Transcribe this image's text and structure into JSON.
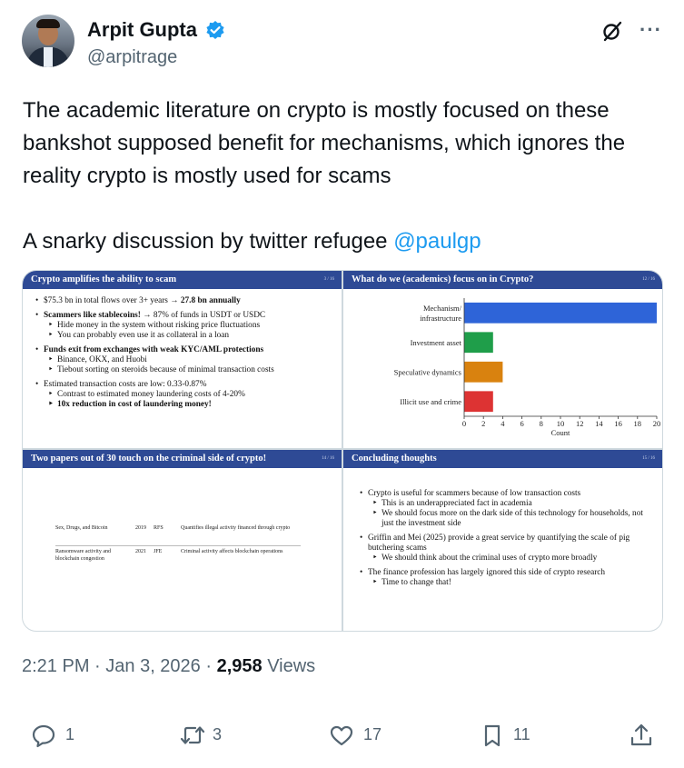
{
  "author": {
    "name": "Arpit Gupta",
    "handle": "@arpitrage"
  },
  "tweet": {
    "paragraph1": "The academic literature on crypto is mostly focused on these bankshot supposed benefit for mechanisms, which ignores the reality crypto is mostly used for scams",
    "paragraph2_prefix": "A snarky discussion by twitter refugee ",
    "mention": "@paulgp"
  },
  "slides": {
    "slide1": {
      "title": "Crypto amplifies the ability to scam",
      "page": "3 / 16",
      "b1_pre": "$75.3 bn in total flows over 3+ years → ",
      "b1_bold": "27.8 bn annually",
      "b2_bold": "Scammers like stablecoins!",
      "b2_rest": " → 87% of funds in USDT or USDC",
      "b2_sub1": "Hide money in the system without risking price fluctuations",
      "b2_sub2": "You can probably even use it as collateral in a loan",
      "b3_bold": "Funds exit from exchanges with weak KYC/AML protections",
      "b3_sub1": "Binance, OKX, and Huobi",
      "b3_sub2": "Tiebout sorting on steroids because of minimal transaction costs",
      "b4": "Estimated transaction costs are low: 0.33-0.87%",
      "b4_sub1": "Contrast to estimated money laundering costs of 4-20%",
      "b4_sub2_bold": "10x reduction in cost of laundering money!"
    },
    "slide2": {
      "title": "What do we (academics) focus on in Crypto?",
      "page": "12 / 16"
    },
    "slide3": {
      "title": "Two papers out of 30 touch on the criminal side of crypto!",
      "page": "14 / 16",
      "rows": [
        {
          "paper": "Sex, Drugs, and Bitcoin",
          "year": "2019",
          "journal": "RFS",
          "finding": "Quantifies illegal activity financed through crypto"
        },
        {
          "paper": "Ransomware activity and blockchain congestion",
          "year": "2021",
          "journal": "JFE",
          "finding": "Criminal activity affects blockchain operations"
        }
      ]
    },
    "slide4": {
      "title": "Concluding thoughts",
      "page": "15 / 16",
      "b1": "Crypto is useful for scammers because of low transaction costs",
      "b1_sub1": "This is an underappreciated fact in academia",
      "b1_sub2": "We should focus more on the dark side of this technology for households, not just the investment side",
      "b2": "Griffin and Mei (2025) provide a great service by quantifying the scale of pig butchering scams",
      "b2_sub1": "We should think about the criminal uses of crypto more broadly",
      "b3": "The finance profession has largely ignored this side of crypto research",
      "b3_sub1": "Time to change that!"
    }
  },
  "chart_data": {
    "type": "bar",
    "orientation": "horizontal",
    "categories": [
      "Mechanism/ infrastructure",
      "Investment asset",
      "Speculative dynamics",
      "Illicit use and crime"
    ],
    "category_lines": [
      [
        "Mechanism/",
        "infrastructure"
      ],
      [
        "Investment asset"
      ],
      [
        "Speculative dynamics"
      ],
      [
        "Illicit use and crime"
      ]
    ],
    "values": [
      20,
      3,
      4,
      3
    ],
    "colors": [
      "#2e64d8",
      "#1f9e4a",
      "#d9820f",
      "#dd3333"
    ],
    "xlabel": "Count",
    "xlim": [
      0,
      20
    ],
    "xticks": [
      0,
      2,
      4,
      6,
      8,
      10,
      12,
      14,
      16,
      18,
      20
    ],
    "xtick_labels": [
      "0",
      "2",
      "4",
      "6",
      "8",
      "10",
      "12",
      "14",
      "16",
      "18",
      "20"
    ]
  },
  "meta": {
    "time": "2:21 PM",
    "sep1": " · ",
    "date": "Jan 3, 2026",
    "sep2": " · ",
    "views_count": "2,958",
    "views_label": " Views"
  },
  "actions": {
    "replies": "1",
    "reposts": "3",
    "likes": "17",
    "bookmarks": "11"
  },
  "colors": {
    "accent": "#1d9bf0",
    "slide_header": "#2e4a95",
    "muted_text": "#536471"
  },
  "icons": {
    "verified": "verified-badge-icon",
    "grok": "grok-icon",
    "more": "more-icon",
    "reply": "reply-icon",
    "repost": "repost-icon",
    "like": "like-icon",
    "bookmark": "bookmark-icon",
    "share": "share-icon"
  }
}
